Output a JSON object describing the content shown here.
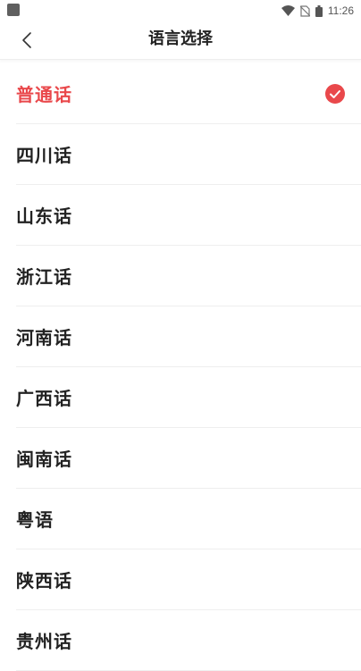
{
  "status_bar": {
    "time": "11:26",
    "icons": [
      "app-square-icon",
      "wifi-icon",
      "no-sim-icon",
      "battery-icon"
    ]
  },
  "nav": {
    "back_icon": "chevron-left-icon",
    "title": "语言选择"
  },
  "colors": {
    "accent": "#e9484b",
    "text": "#222222",
    "divider": "#eeeeee"
  },
  "languages": [
    {
      "label": "普通话",
      "selected": true
    },
    {
      "label": "四川话",
      "selected": false
    },
    {
      "label": "山东话",
      "selected": false
    },
    {
      "label": "浙江话",
      "selected": false
    },
    {
      "label": "河南话",
      "selected": false
    },
    {
      "label": "广西话",
      "selected": false
    },
    {
      "label": "闽南话",
      "selected": false
    },
    {
      "label": "粤语",
      "selected": false
    },
    {
      "label": "陕西话",
      "selected": false
    },
    {
      "label": "贵州话",
      "selected": false
    }
  ]
}
